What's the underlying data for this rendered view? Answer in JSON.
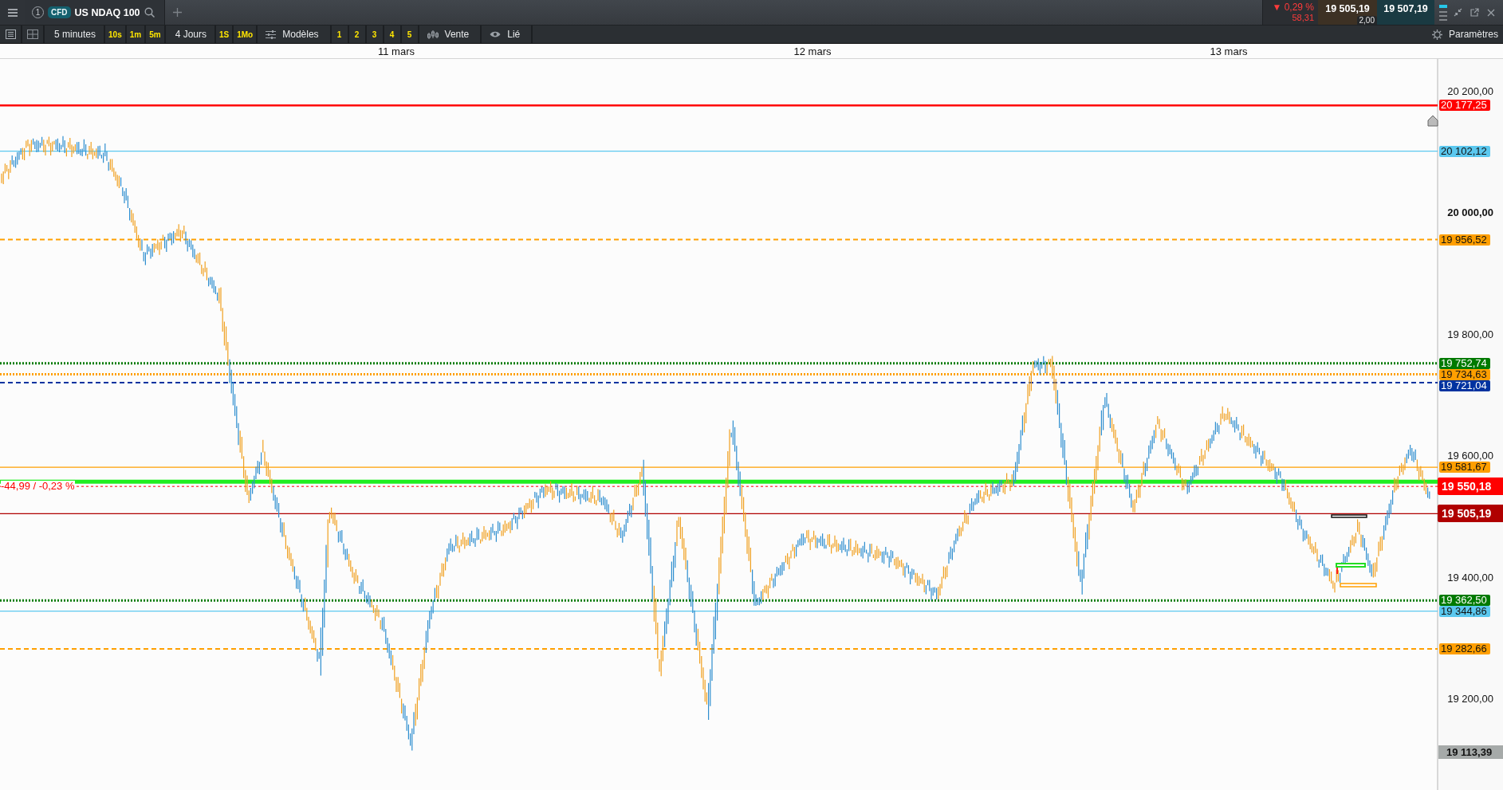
{
  "tab": {
    "number": "1",
    "badge": "CFD",
    "title": "US NDAQ 100"
  },
  "quote": {
    "change": "▼ 0,29 %",
    "change_points": "58,31",
    "bid": "19 505,19",
    "ask": "19 507,19",
    "spread": "2,00"
  },
  "toolbar": [
    {
      "kind": "text",
      "label": "5 minutes"
    },
    {
      "kind": "quick",
      "label": "10s"
    },
    {
      "kind": "quick",
      "label": "1m"
    },
    {
      "kind": "quick",
      "label": "5m"
    },
    {
      "kind": "text",
      "label": "4 Jours"
    },
    {
      "kind": "quick",
      "label": "1S"
    },
    {
      "kind": "quick",
      "label": "1Mo"
    },
    {
      "kind": "templates",
      "label": "Modèles"
    },
    {
      "kind": "quick",
      "label": "1"
    },
    {
      "kind": "quick",
      "label": "2"
    },
    {
      "kind": "quick",
      "label": "3"
    },
    {
      "kind": "quick",
      "label": "4"
    },
    {
      "kind": "quick",
      "label": "5"
    },
    {
      "kind": "candles",
      "label": "Vente"
    },
    {
      "kind": "eye",
      "label": "Lié"
    }
  ],
  "settings": "Paramètres",
  "dates": [
    "11 mars",
    "12 mars",
    "13 mars"
  ],
  "y_ticks": [
    {
      "label": "20 200,00",
      "major": false
    },
    {
      "label": "20 000,00",
      "major": true
    },
    {
      "label": "19 800,00",
      "major": false
    },
    {
      "label": "19 600,00",
      "major": false
    },
    {
      "label": "19 400,00",
      "major": false
    },
    {
      "label": "19 200,00",
      "major": false
    }
  ],
  "levels": [
    {
      "label": "20 177,25",
      "color": "#ff0000",
      "kind": "solid",
      "big": false
    },
    {
      "label": "20 102,12",
      "color": "#5bc8ef",
      "kind": "thin",
      "big": false
    },
    {
      "label": "19 956,52",
      "color": "#ff9f00",
      "kind": "dashed",
      "big": false
    },
    {
      "label": "19 752,74",
      "color": "#007a00",
      "kind": "dotted",
      "big": false
    },
    {
      "label": "19 734,63",
      "color": "#ff9f00",
      "kind": "dotted",
      "big": false
    },
    {
      "label": "19 721,04",
      "color": "#0033a0",
      "kind": "dashed",
      "big": false
    },
    {
      "label": "19 581,67",
      "color": "#ff9f00",
      "kind": "thin",
      "big": false
    },
    {
      "label": "19 550,18",
      "color": "#ff0000",
      "kind": "finedotted",
      "big": true,
      "note": "-44,99 / -0,23 %"
    },
    {
      "label": "19 505,19",
      "color": "#b00000",
      "kind": "thin",
      "big": true
    },
    {
      "label": "19 362,50",
      "color": "#007a00",
      "kind": "dotted",
      "big": false
    },
    {
      "label": "19 344,86",
      "color": "#5bc8ef",
      "kind": "thin",
      "big": false
    },
    {
      "label": "19 282,66",
      "color": "#ff9f00",
      "kind": "dashed",
      "big": false
    }
  ],
  "low_label": "19 113,39"
}
